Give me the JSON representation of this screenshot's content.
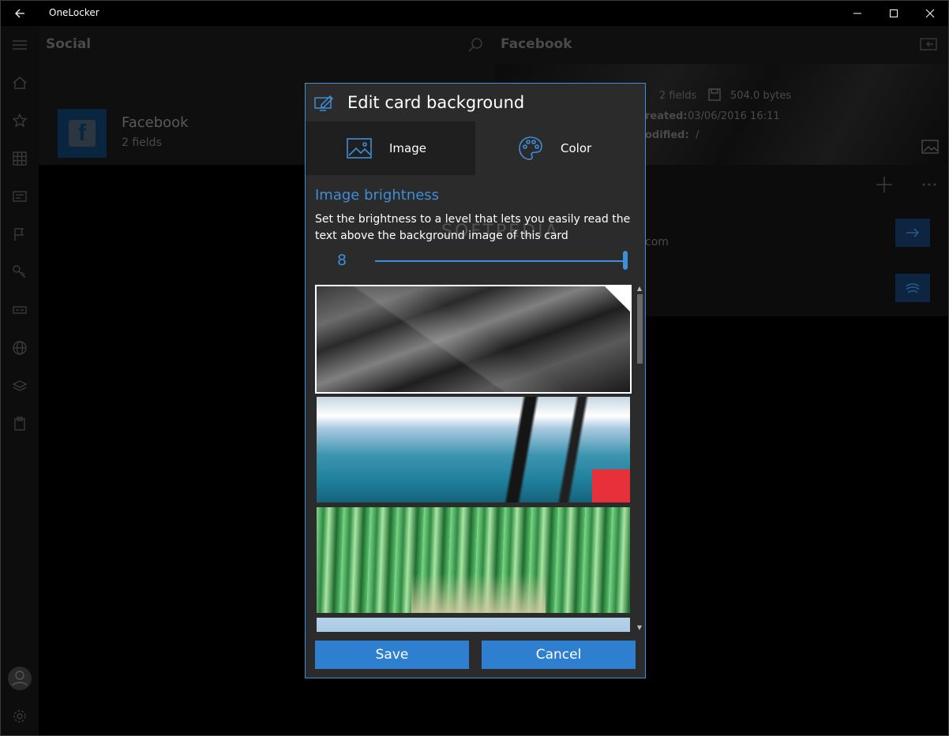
{
  "window": {
    "title": "OneLocker"
  },
  "left_pane": {
    "title": "Social",
    "card": {
      "name": "Facebook",
      "fields": "2 fields"
    }
  },
  "right_pane": {
    "title": "Facebook",
    "fields": "2 fields",
    "size": "504.0 bytes",
    "created_label": "reated:",
    "created_value": "03/06/2016 16:11",
    "modified_label": "odified:",
    "modified_value": "/",
    "email_fragment": "com"
  },
  "dialog": {
    "title": "Edit card background",
    "tabs": [
      {
        "label": "Image",
        "icon": "image-icon"
      },
      {
        "label": "Color",
        "icon": "palette-icon"
      }
    ],
    "section_title": "Image brightness",
    "section_desc": "Set the brightness to a level that lets you easily read the text above the background image of this card",
    "brightness": 8,
    "brightness_max": 8,
    "save_label": "Save",
    "cancel_label": "Cancel"
  },
  "watermark": "SOFTPEDIA",
  "colors": {
    "accent": "#3e8ed8",
    "button": "#2f7fd0",
    "dialog_bg": "#2b2b2b"
  }
}
